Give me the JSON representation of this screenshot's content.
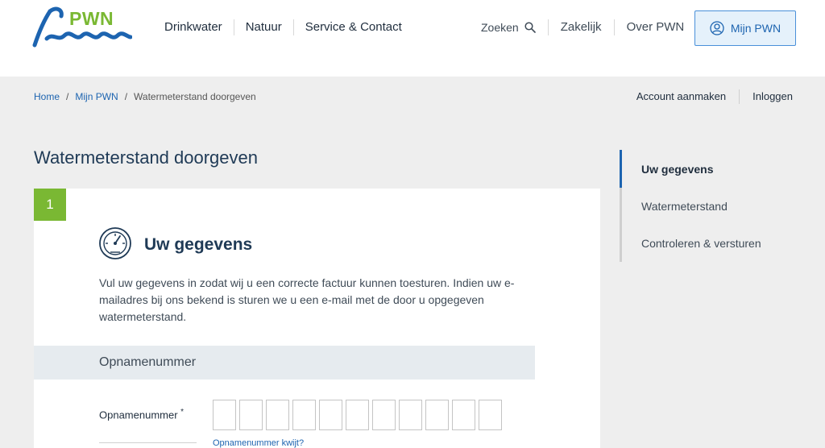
{
  "header": {
    "logo_text": "PWN",
    "nav": [
      "Drinkwater",
      "Natuur",
      "Service & Contact"
    ],
    "search_label": "Zoeken",
    "secondary_nav": [
      "Zakelijk",
      "Over PWN"
    ],
    "mijn_pwn_label": "Mijn PWN"
  },
  "breadcrumb": {
    "items": [
      "Home",
      "Mijn PWN"
    ],
    "current": "Watermeterstand doorgeven",
    "separator": "/"
  },
  "account": {
    "create_label": "Account aanmaken",
    "login_label": "Inloggen"
  },
  "page_title": "Watermeterstand doorgeven",
  "form": {
    "step_number": "1",
    "section_title": "Uw gegevens",
    "intro": "Vul uw gegevens in zodat wij u een correcte factuur kunnen toesturen. Indien uw e-mailadres bij ons bekend is sturen we u een e-mail met de door u opgegeven watermeterstand.",
    "subhead": "Opnamenummer",
    "field_label": "Opnamenummer",
    "required_mark": "*",
    "digit_count": 11,
    "lost_link": "Opnamenummer kwijt?"
  },
  "steps": [
    {
      "label": "Uw gegevens",
      "active": true
    },
    {
      "label": "Watermeterstand",
      "active": false
    },
    {
      "label": "Controleren & versturen",
      "active": false
    }
  ],
  "colors": {
    "brand_blue": "#1d64b0",
    "brand_green": "#7ab833",
    "navy": "#1f3a56"
  }
}
